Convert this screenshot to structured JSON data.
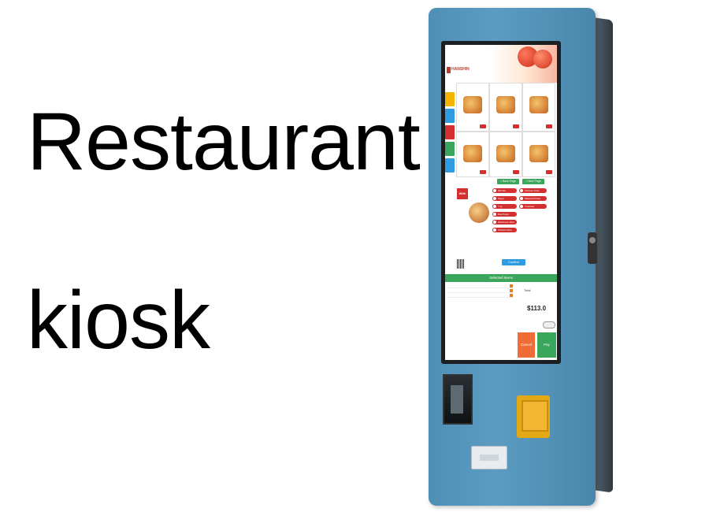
{
  "headline": {
    "line1": "Restaurant",
    "line2": "kiosk"
  },
  "screen": {
    "brand": "HANSHIN",
    "nav": {
      "prev": "< Back Page",
      "next": "> Next Page"
    },
    "with_badge": "With",
    "options": [
      "Mirinda",
      "7 up",
      "Diet Pepsi",
      "Pepsi",
      "Mashed Potato",
      "Coleslaw",
      "Mushroom Rice",
      "Chicken Rice",
      "Chinese Fries"
    ],
    "confirm": "Confirm",
    "selected_items": "Selected Items",
    "total_label": "Total",
    "total_value": "$113.0",
    "cancel": "Cancel",
    "pay": "Pay"
  },
  "colors": {
    "kiosk_blue": "#4f8fb5",
    "accent_green": "#3aa65b",
    "accent_red": "#d32f2f",
    "cancel_orange": "#ef6c37",
    "card_reader": "#e3a914"
  }
}
